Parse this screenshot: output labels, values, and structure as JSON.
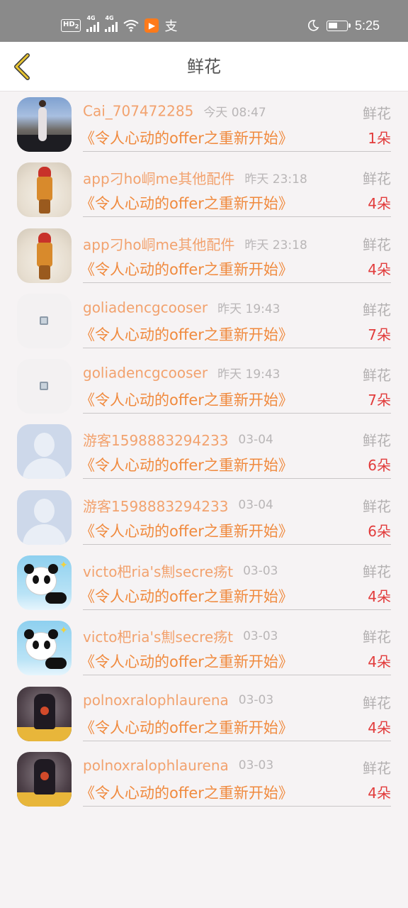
{
  "status_bar": {
    "hd_label": "HD",
    "hd_sub": "2",
    "sig1_label": "4G",
    "sig2_label": "4G",
    "app_badge": "▶",
    "alipay": "支",
    "time": "5:25"
  },
  "header": {
    "title": "鲜花"
  },
  "items": [
    {
      "username": "Cai_707472285",
      "time": "今天 08:47",
      "gift": "鲜花",
      "message": "《令人心动的offer之重新开始》",
      "count": "1朵",
      "avatar": "street-photo"
    },
    {
      "username": "app刁ho峒me其他配件",
      "time": "昨天 23:18",
      "gift": "鲜花",
      "message": "《令人心动的offer之重新开始》",
      "count": "4朵",
      "avatar": "girl-orange"
    },
    {
      "username": "app刁ho峒me其他配件",
      "time": "昨天 23:18",
      "gift": "鲜花",
      "message": "《令人心动的offer之重新开始》",
      "count": "4朵",
      "avatar": "girl-orange"
    },
    {
      "username": "goliadencgcooser",
      "time": "昨天 19:43",
      "gift": "鲜花",
      "message": "《令人心动的offer之重新开始》",
      "count": "7朵",
      "avatar": "robot-small"
    },
    {
      "username": "goliadencgcooser",
      "time": "昨天 19:43",
      "gift": "鲜花",
      "message": "《令人心动的offer之重新开始》",
      "count": "7朵",
      "avatar": "robot-small"
    },
    {
      "username": "游客1598883294233",
      "time": "03-04",
      "gift": "鲜花",
      "message": "《令人心动的offer之重新开始》",
      "count": "6朵",
      "avatar": "default-user"
    },
    {
      "username": "游客1598883294233",
      "time": "03-04",
      "gift": "鲜花",
      "message": "《令人心动的offer之重新开始》",
      "count": "6朵",
      "avatar": "default-user"
    },
    {
      "username": "victo杷ria's劁secre疡t",
      "time": "03-03",
      "gift": "鲜花",
      "message": "《令人心动的offer之重新开始》",
      "count": "4朵",
      "avatar": "panda"
    },
    {
      "username": "victo杷ria's劁secre疡t",
      "time": "03-03",
      "gift": "鲜花",
      "message": "《令人心动的offer之重新开始》",
      "count": "4朵",
      "avatar": "panda"
    },
    {
      "username": "polnoxralophlaurena",
      "time": "03-03",
      "gift": "鲜花",
      "message": "《令人心动的offer之重新开始》",
      "count": "4朵",
      "avatar": "dark-figure"
    },
    {
      "username": "polnoxralophlaurena",
      "time": "03-03",
      "gift": "鲜花",
      "message": "《令人心动的offer之重新开始》",
      "count": "4朵",
      "avatar": "dark-figure"
    }
  ],
  "colors": {
    "username": "#f2a26e",
    "message": "#f08a3e",
    "count": "#e23c3c",
    "back_arrow": "#e9c531"
  }
}
